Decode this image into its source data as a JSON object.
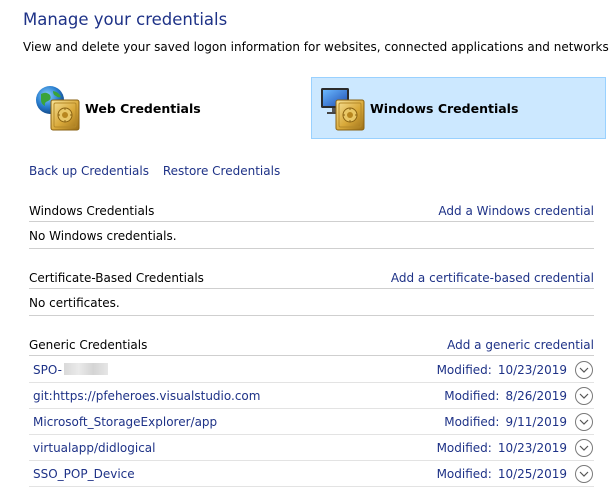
{
  "header": {
    "title": "Manage your credentials",
    "subtitle": "View and delete your saved logon information for websites, connected applications and networks."
  },
  "tiles": {
    "web": {
      "label": "Web Credentials",
      "icon": "globe-vault-icon"
    },
    "windows": {
      "label": "Windows Credentials",
      "icon": "computer-vault-icon",
      "selected": true
    }
  },
  "actions": {
    "backup": "Back up Credentials",
    "restore": "Restore Credentials"
  },
  "sections": {
    "windows": {
      "title": "Windows Credentials",
      "add_link": "Add a Windows credential",
      "empty_text": "No Windows credentials."
    },
    "certificate": {
      "title": "Certificate-Based Credentials",
      "add_link": "Add a certificate-based credential",
      "empty_text": "No certificates."
    },
    "generic": {
      "title": "Generic Credentials",
      "add_link": "Add a generic credential",
      "modified_label": "Modified:",
      "items": [
        {
          "name": "SPO-",
          "redacted": true,
          "modified": "10/23/2019"
        },
        {
          "name": "git:https://pfeheroes.visualstudio.com",
          "modified": "8/26/2019"
        },
        {
          "name": "Microsoft_StorageExplorer/app",
          "modified": "9/11/2019"
        },
        {
          "name": "virtualapp/didlogical",
          "modified": "10/23/2019"
        },
        {
          "name": "SSO_POP_Device",
          "modified": "10/25/2019"
        }
      ]
    }
  },
  "colors": {
    "link": "#1e3287",
    "selected_tile_bg": "#cce8ff",
    "selected_tile_border": "#99d1ff",
    "divider": "#cfcfcf"
  }
}
